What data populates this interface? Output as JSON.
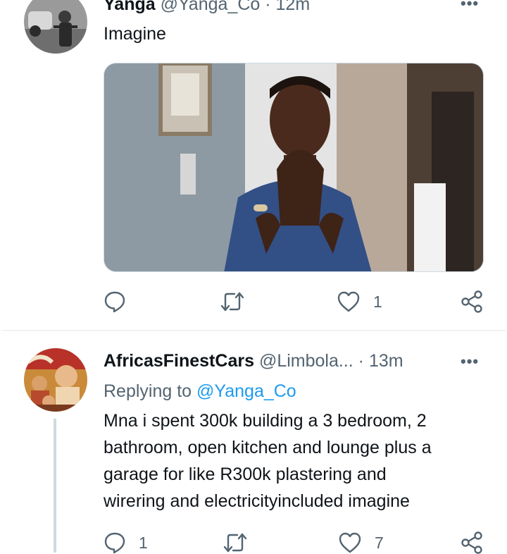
{
  "tweet1": {
    "display_name": "Yanga",
    "handle": "@Yanga_Co",
    "separator": "·",
    "time": "12m",
    "more_icon": "more-horizontal-icon",
    "text": "Imagine",
    "media_alt": "GIF: man with hands pressed together over his mouth",
    "actions": {
      "reply": {
        "icon": "reply-icon",
        "count": ""
      },
      "retweet": {
        "icon": "retweet-icon",
        "count": ""
      },
      "like": {
        "icon": "heart-icon",
        "count": "1"
      },
      "share": {
        "icon": "share-icon",
        "count": ""
      }
    }
  },
  "tweet2": {
    "display_name": "AfricasFinestCars",
    "handle": "@Limbola...",
    "separator": "·",
    "time": "13m",
    "more_icon": "more-horizontal-icon",
    "replying_prefix": "Replying to",
    "replying_to": "@Yanga_Co",
    "text_lines": [
      "Mna i spent 300k building a 3 bedroom, 2",
      "bathroom, open kitchen and lounge plus a",
      "garage for like R300k plastering and",
      "wirering and electricityincluded imagine"
    ],
    "actions": {
      "reply": {
        "icon": "reply-icon",
        "count": "1"
      },
      "retweet": {
        "icon": "retweet-icon",
        "count": ""
      },
      "like": {
        "icon": "heart-icon",
        "count": "7"
      },
      "share": {
        "icon": "share-icon",
        "count": ""
      }
    }
  },
  "colors": {
    "link": "#1d9bf0",
    "muted": "#536471",
    "text": "#0f1419",
    "divider": "#eff3f4"
  }
}
